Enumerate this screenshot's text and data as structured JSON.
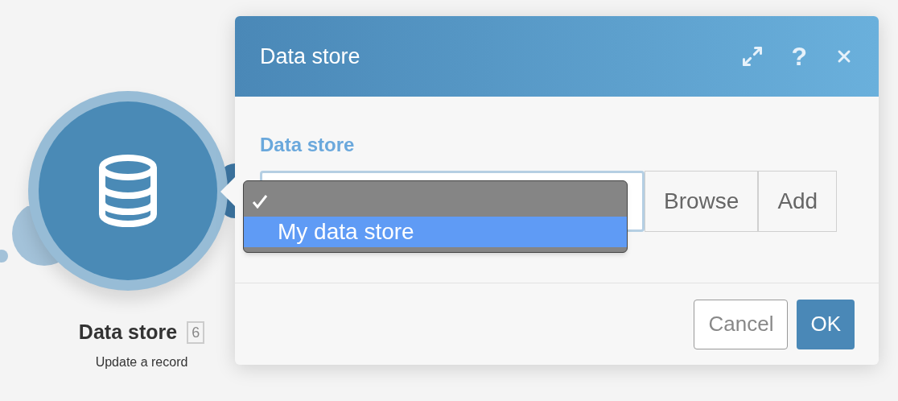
{
  "node": {
    "title": "Data store",
    "badge": "6",
    "subtitle": "Update a record"
  },
  "dialog": {
    "title": "Data store",
    "help": "?",
    "field": {
      "label": "Data store",
      "buttons": [
        "Browse",
        "Add"
      ]
    },
    "menu": [
      {
        "selected": true,
        "highlighted": false
      },
      {
        "label": "My data store",
        "selected": false,
        "highlighted": true
      }
    ],
    "footer": [
      {
        "label": "Cancel",
        "kind": "secondary"
      },
      {
        "label": "OK",
        "kind": "primary"
      }
    ]
  }
}
